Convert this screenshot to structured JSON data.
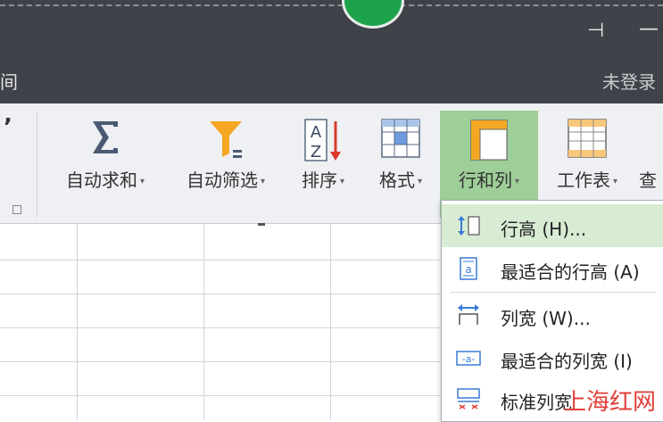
{
  "title_bar": {
    "partial_tab": "间",
    "pin_glyph": "⊣",
    "minimize_glyph": "—",
    "login_status": "未登录"
  },
  "ribbon": {
    "partial_glyph": "’",
    "buttons": [
      {
        "label": "自动求和",
        "icon": "sigma-icon",
        "has_dropdown": true
      },
      {
        "label": "自动筛选",
        "icon": "filter-funnel-icon",
        "has_dropdown": true
      },
      {
        "label": "排序",
        "icon": "sort-az-icon",
        "has_dropdown": true
      },
      {
        "label": "格式",
        "icon": "format-grid-icon",
        "has_dropdown": true
      },
      {
        "label": "行和列",
        "icon": "rows-columns-icon",
        "has_dropdown": true,
        "active": true
      },
      {
        "label": "工作表",
        "icon": "worksheet-icon",
        "has_dropdown": true
      },
      {
        "label": "查",
        "icon": "",
        "has_dropdown": false
      }
    ],
    "dropdown_arrow": "▾"
  },
  "menu": {
    "items": [
      {
        "label": "行高 (H)...",
        "icon": "row-height-icon",
        "highlighted": true
      },
      {
        "label": "最适合的行高 (A)",
        "icon": "best-fit-row-height-icon"
      },
      {
        "label": "列宽 (W)...",
        "icon": "column-width-icon"
      },
      {
        "label": "最适合的列宽 (I)",
        "icon": "best-fit-column-width-icon"
      },
      {
        "label": "标准列宽",
        "icon": "standard-column-width-icon"
      }
    ]
  },
  "watermark": "上海红网",
  "colors": {
    "title_bar_bg": "#3f4248",
    "ribbon_bg": "#eef0f3",
    "active_button_bg": "#9fcf98",
    "menu_highlight": "#d8ecd3",
    "accent_blue": "#3a7bd5",
    "accent_orange": "#f5a623"
  }
}
